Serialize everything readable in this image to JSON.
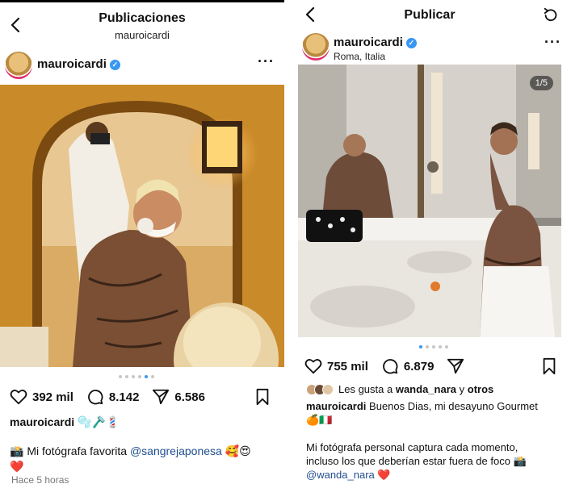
{
  "left": {
    "nav": {
      "title": "Publicaciones",
      "subtitle": "mauroicardi"
    },
    "post": {
      "username": "mauroicardi",
      "likes": "392 mil",
      "comments": "8.142",
      "shares": "6.586",
      "caption_user": "mauroicardi",
      "caption_emojis": "🫧🪒💈",
      "caption2_prefix": "📸",
      "caption2_text": "Mi fotógrafa favorita",
      "caption2_mention": "@sangrejaponesa",
      "caption2_suffix": "🥰😍",
      "caption2_heart": "❤️",
      "time": "Hace 5 horas"
    }
  },
  "right": {
    "nav": {
      "title": "Publicar"
    },
    "post": {
      "username": "mauroicardi",
      "location": "Roma, Italia",
      "counter": "1/5",
      "likes": "755 mil",
      "comments": "6.879",
      "liked_by_prefix": "Les gusta a",
      "liked_by_user": "wanda_nara",
      "liked_by_and": "y",
      "liked_by_others": "otros",
      "caption_user": "mauroicardi",
      "caption_text": "Buenos Dias, mi desayuno Gourmet",
      "caption_emojis": "🍊🇮🇹",
      "caption2_line1": "Mi fotógrafa personal captura cada momento,",
      "caption2_line2": "incluso los que deberían estar fuera de foco 📸",
      "caption2_mention": "@wanda_nara",
      "caption2_heart": "❤️"
    }
  },
  "colors": {
    "verified": "#3897f0",
    "dot_active": "#3897f0",
    "mention": "#1f4d8f"
  },
  "icons": [
    "back-icon",
    "more-icon",
    "heart-icon",
    "comment-icon",
    "share-icon",
    "bookmark-icon",
    "refresh-icon",
    "verified-icon"
  ]
}
